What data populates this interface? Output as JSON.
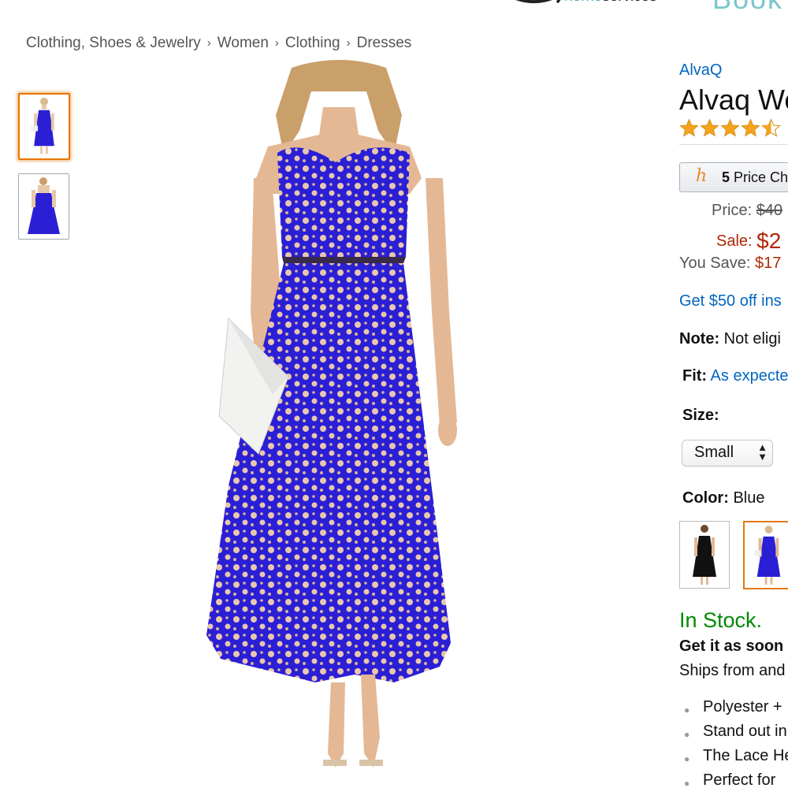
{
  "header": {
    "home_label": "home",
    "services_label": "services",
    "book_label": "Book"
  },
  "breadcrumb": [
    "Clothing, Shoes & Jewelry",
    "Women",
    "Clothing",
    "Dresses"
  ],
  "breadcrumb_separator": "›",
  "gallery": {
    "thumbnails": [
      "front-view",
      "back-view"
    ],
    "selected_index": 0,
    "dress_color": "#2b1fd6",
    "skin_color": "#e8c8a8"
  },
  "product": {
    "brand": "AlvaQ",
    "title": "Alvaq Wo",
    "rating": 4.5,
    "rating_max": 5,
    "price_chart_count": "5",
    "price_chart_label": "Price Ch",
    "price_label": "Price:",
    "list_price": "$40",
    "sale_label": "Sale:",
    "sale_price": "$2",
    "save_label": "You Save:",
    "save_value": "$17",
    "promo": "Get $50 off ins",
    "note_label": "Note:",
    "note_text": "Not eligi",
    "fit_label": "Fit:",
    "fit_value": "As expecte",
    "size_label": "Size:",
    "size_selected": "Small",
    "color_label": "Color:",
    "color_value": "Blue",
    "color_options": [
      "black",
      "blue"
    ],
    "availability": "In Stock.",
    "delivery": "Get it as soon",
    "ships": "Ships from and",
    "features": [
      "Polyester +",
      "Stand out in",
      "The Lace He",
      "Perfect for"
    ]
  },
  "colors": {
    "link": "#0066c0",
    "price_red": "#b12704",
    "in_stock_green": "#008a00",
    "star_gold": "#f4a41c",
    "selection_orange": "#e77600"
  }
}
